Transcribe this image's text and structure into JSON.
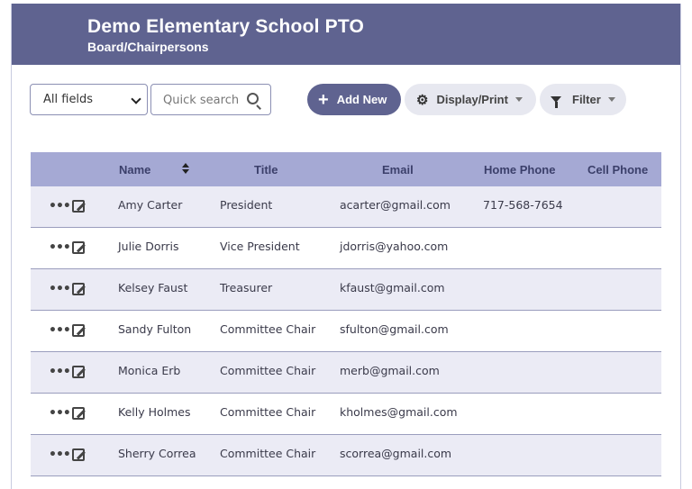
{
  "header": {
    "title": "Demo Elementary School PTO",
    "subtitle": "Board/Chairpersons"
  },
  "toolbar": {
    "field_select_value": "All fields",
    "search_placeholder": "Quick search",
    "add_label": "Add New",
    "display_label": "Display/Print",
    "filter_label": "Filter"
  },
  "colors": {
    "header_bg": "#5f6390",
    "table_header_bg": "#a5a9d4",
    "row_alt_bg": "#ebebf5"
  },
  "table": {
    "columns": [
      "Name",
      "Title",
      "Email",
      "Home Phone",
      "Cell Phone"
    ],
    "rows": [
      {
        "name": "Amy Carter",
        "title": "President",
        "email": "acarter@gmail.com",
        "home_phone": "717-568-7654",
        "cell_phone": ""
      },
      {
        "name": "Julie Dorris",
        "title": "Vice President",
        "email": "jdorris@yahoo.com",
        "home_phone": "",
        "cell_phone": ""
      },
      {
        "name": "Kelsey Faust",
        "title": "Treasurer",
        "email": "kfaust@gmail.com",
        "home_phone": "",
        "cell_phone": ""
      },
      {
        "name": "Sandy Fulton",
        "title": "Committee Chair",
        "email": "sfulton@gmail.com",
        "home_phone": "",
        "cell_phone": ""
      },
      {
        "name": "Monica Erb",
        "title": "Committee Chair",
        "email": "merb@gmail.com",
        "home_phone": "",
        "cell_phone": ""
      },
      {
        "name": "Kelly Holmes",
        "title": "Committee Chair",
        "email": "kholmes@gmail.com",
        "home_phone": "",
        "cell_phone": ""
      },
      {
        "name": "Sherry Correa",
        "title": "Committee Chair",
        "email": "scorrea@gmail.com",
        "home_phone": "",
        "cell_phone": ""
      }
    ]
  }
}
